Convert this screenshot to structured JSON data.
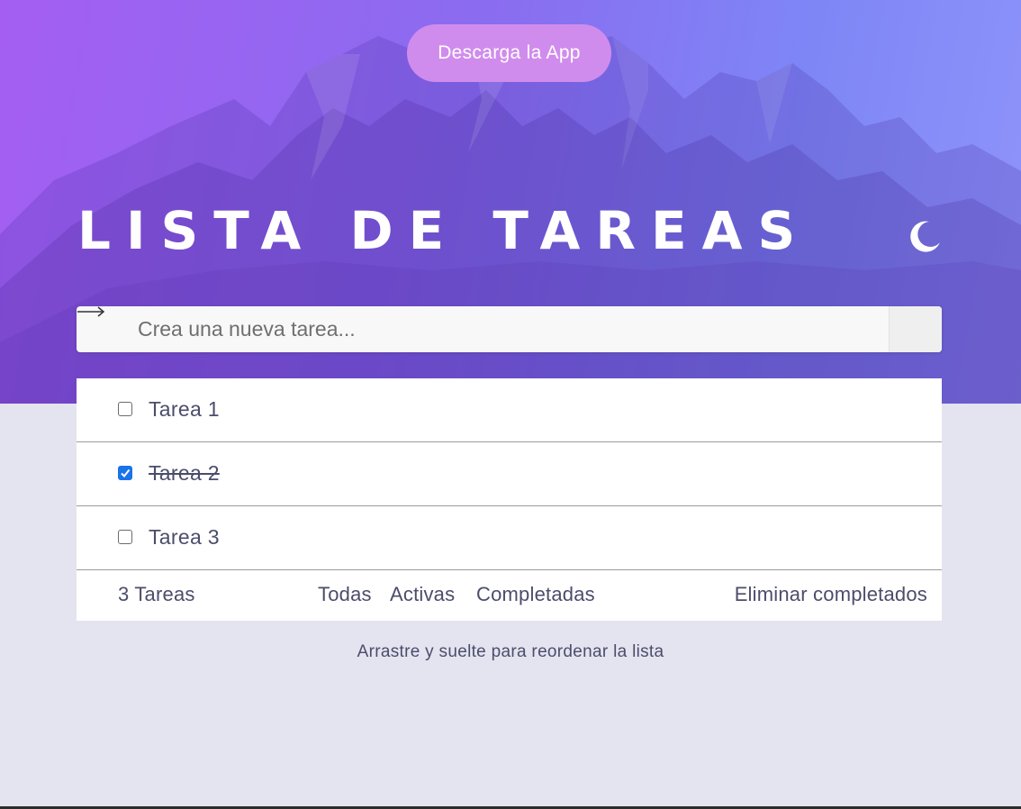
{
  "header": {
    "download_label": "Descarga la App",
    "title": "LISTA DE TAREAS",
    "theme_toggle_icon": "moon-icon"
  },
  "new_task": {
    "placeholder": "Crea una nueva tarea...",
    "value": "",
    "submit_icon": "arrow-right-icon"
  },
  "tasks": [
    {
      "label": "Tarea 1",
      "completed": false
    },
    {
      "label": "Tarea 2",
      "completed": true
    },
    {
      "label": "Tarea 3",
      "completed": false
    }
  ],
  "footer": {
    "count_label": "3 Tareas",
    "filter_all": "Todas",
    "filter_active": "Activas",
    "filter_completed": "Completadas",
    "clear_completed": "Eliminar completados"
  },
  "hint": "Arrastre y suelte para reordenar la lista",
  "colors": {
    "gradient_start": "#a45ef2",
    "gradient_end": "#8f94fa",
    "download_button": "#d08cec",
    "page_background": "#e4e4f0",
    "text": "#4b4d6b",
    "checkbox_checked": "#1a73e8"
  }
}
